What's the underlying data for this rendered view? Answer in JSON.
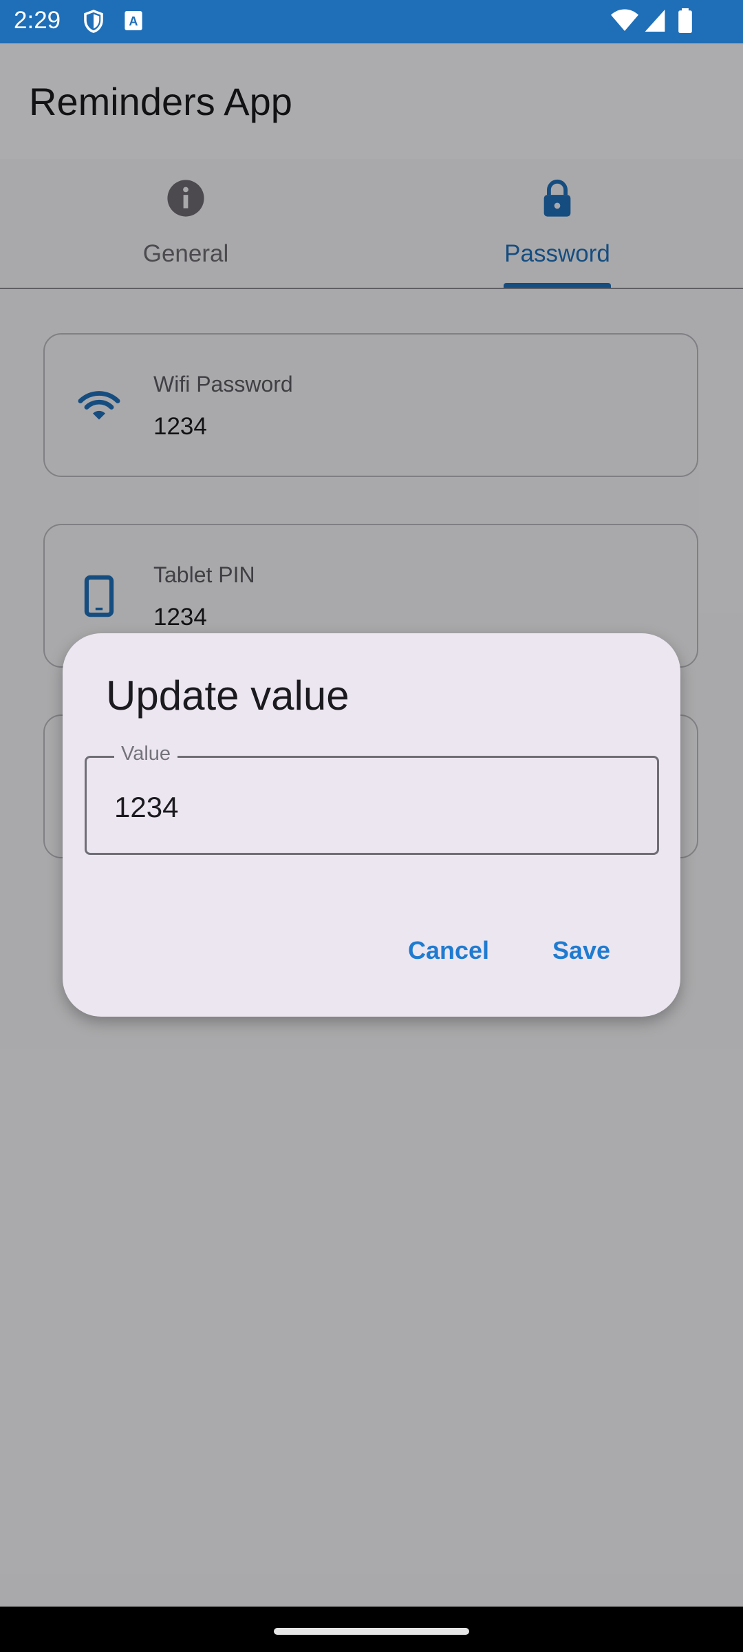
{
  "status_bar": {
    "time": "2:29",
    "icons": [
      "shield-icon",
      "font-a-icon",
      "wifi-icon",
      "signal-icon",
      "battery-icon"
    ],
    "background": "#1f6fb8"
  },
  "app_bar": {
    "title": "Reminders App"
  },
  "tabs": [
    {
      "label": "General",
      "icon": "info-icon",
      "selected": false
    },
    {
      "label": "Password",
      "icon": "lock-icon",
      "selected": true
    }
  ],
  "cards": [
    {
      "label": "Wifi Password",
      "value": "1234",
      "icon": "wifi-icon"
    },
    {
      "label": "Tablet PIN",
      "value": "1234",
      "icon": "tablet-icon"
    }
  ],
  "dialog": {
    "title": "Update value",
    "field_label": "Value",
    "field_value": "1234",
    "cancel_label": "Cancel",
    "save_label": "Save"
  },
  "colors": {
    "accent": "#1f6fb8",
    "button_text": "#1f7bd0",
    "dialog_bg": "#ece6f0"
  }
}
